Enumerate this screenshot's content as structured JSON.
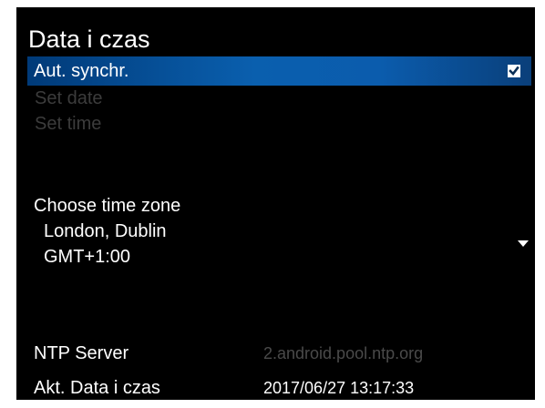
{
  "screen": {
    "title": "Data i czas"
  },
  "menu": {
    "auto_sync": {
      "label": "Aut. synchr.",
      "checked": true
    },
    "set_date": {
      "label": "Set date"
    },
    "set_time": {
      "label": "Set time"
    }
  },
  "timezone": {
    "label": "Choose time zone",
    "city": "London, Dublin",
    "offset": "GMT+1:00"
  },
  "info": {
    "ntp_label": "NTP Server",
    "ntp_value": "2.android.pool.ntp.org",
    "datetime_label": "Akt. Data i czas",
    "datetime_value": "2017/06/27 13:17:33"
  },
  "colors": {
    "highlight": "#0b5cad",
    "disabled_text": "#3c3c3c",
    "background": "#000000"
  }
}
